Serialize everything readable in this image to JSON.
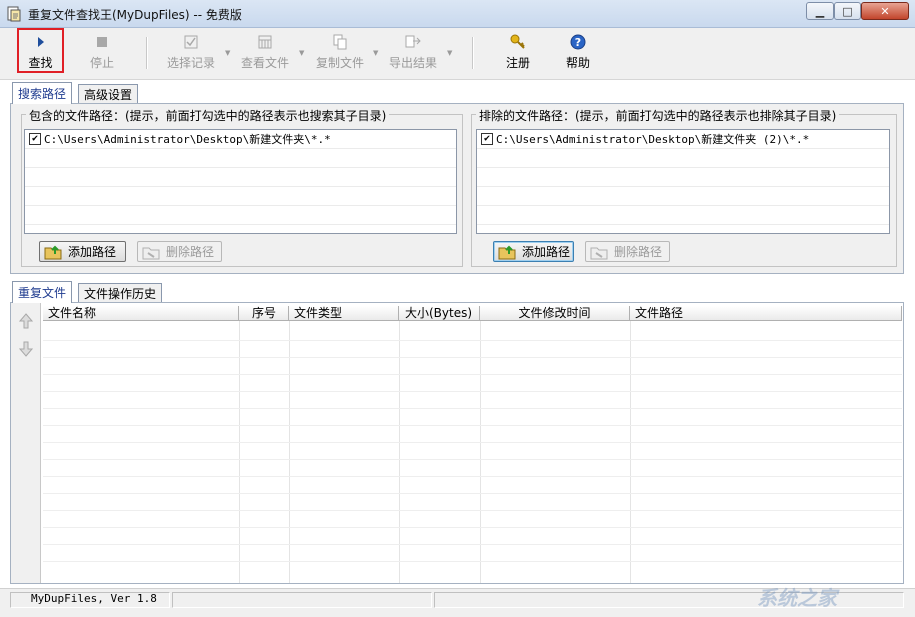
{
  "window": {
    "title": "重复文件查找王(MyDupFiles) -- 免费版"
  },
  "toolbar": {
    "find": "查找",
    "stop": "停止",
    "select_records": "选择记录",
    "view_file": "查看文件",
    "copy_file": "复制文件",
    "export_results": "导出结果",
    "register": "注册",
    "help": "帮助"
  },
  "search_tabs": [
    "搜索路径",
    "高级设置"
  ],
  "include": {
    "title": "包含的文件路径：(提示，前面打勾选中的路径表示也搜索其子目录)",
    "paths": [
      {
        "checked": true,
        "path": "C:\\Users\\Administrator\\Desktop\\新建文件夹\\*.*"
      }
    ],
    "add_label": "添加路径",
    "delete_label": "删除路径"
  },
  "exclude": {
    "title": "排除的文件路径：(提示，前面打勾选中的路径表示也排除其子目录)",
    "paths": [
      {
        "checked": true,
        "path": "C:\\Users\\Administrator\\Desktop\\新建文件夹 (2)\\*.*"
      }
    ],
    "add_label": "添加路径",
    "delete_label": "删除路径"
  },
  "result_tabs": [
    "重复文件",
    "文件操作历史"
  ],
  "columns": [
    "文件名称",
    "序号",
    "文件类型",
    "大小(Bytes)",
    "文件修改时间",
    "文件路径"
  ],
  "status": {
    "text": "MyDupFiles, Ver 1.8"
  },
  "watermark": "系统之家",
  "colors": {
    "highlight_border": "#e01f26",
    "active_tab_text": "#1f3b8f",
    "close_button": "#c2452c"
  }
}
